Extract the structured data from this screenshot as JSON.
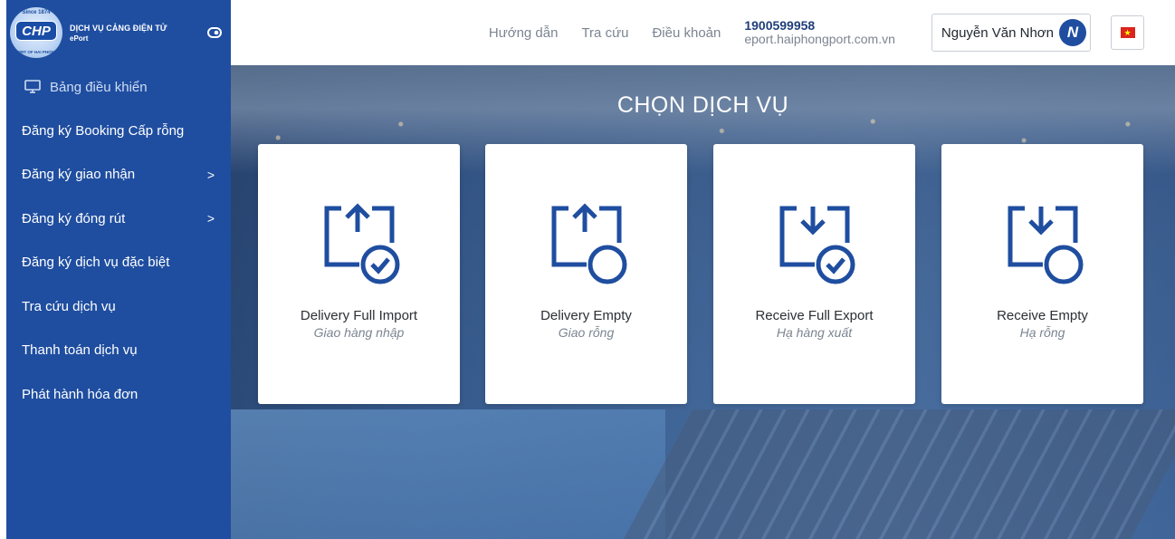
{
  "brand": {
    "badge_since": "Since 1874",
    "badge_abbr": "CHP",
    "badge_port": "PORT OF HAI PHONG",
    "title": "DỊCH VỤ CẢNG ĐIỆN TỬ",
    "subtitle": "ePort"
  },
  "sidebar": {
    "items": [
      {
        "label": "Bảng điều khiển",
        "icon": "monitor-icon"
      },
      {
        "label": "Đăng ký Booking Cấp rỗng"
      },
      {
        "label": "Đăng ký giao nhận",
        "has_submenu": true
      },
      {
        "label": "Đăng ký đóng rút",
        "has_submenu": true
      },
      {
        "label": "Đăng ký dịch vụ đặc biệt"
      },
      {
        "label": "Tra cứu dịch vụ"
      },
      {
        "label": "Thanh toán dịch vụ"
      },
      {
        "label": "Phát hành hóa đơn"
      }
    ],
    "chevron": ">"
  },
  "header": {
    "links": [
      "Hướng dẫn",
      "Tra cứu",
      "Điều khoản"
    ],
    "phone": "1900599958",
    "website": "eport.haiphongport.com.vn",
    "user_name": "Nguyễn Văn Nhơn",
    "user_initial": "N",
    "language_flag": "vietnam-flag-icon"
  },
  "main": {
    "title": "CHỌN DỊCH VỤ",
    "cards": [
      {
        "title": "Delivery Full Import",
        "subtitle": "Giao hàng nhập",
        "arrow": "up",
        "check": true
      },
      {
        "title": "Delivery Empty",
        "subtitle": "Giao rỗng",
        "arrow": "up",
        "check": false
      },
      {
        "title": "Receive Full Export",
        "subtitle": "Hạ hàng xuất",
        "arrow": "down",
        "check": true
      },
      {
        "title": "Receive Empty",
        "subtitle": "Hạ rỗng",
        "arrow": "down",
        "check": false
      }
    ]
  },
  "colors": {
    "sidebar_bg": "#1f4ea0",
    "icon_blue": "#1f4ea0",
    "text_dark": "#2b2f36",
    "text_muted": "#7c8592"
  }
}
